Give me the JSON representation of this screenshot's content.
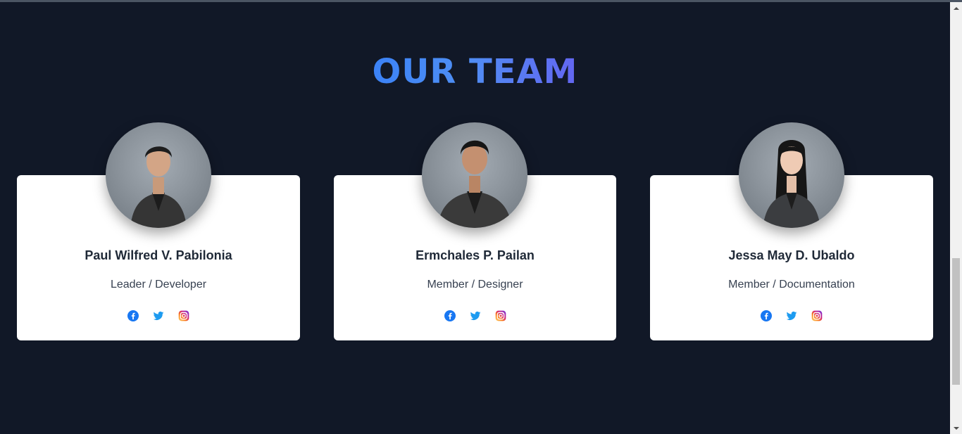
{
  "section": {
    "title": "OUR TEAM"
  },
  "members": [
    {
      "name": "Paul Wilfred V. Pabilonia",
      "role": "Leader / Developer"
    },
    {
      "name": "Ermchales P. Pailan",
      "role": "Member / Designer"
    },
    {
      "name": "Jessa May D. Ubaldo",
      "role": "Member / Documentation"
    }
  ],
  "socials": [
    "facebook-icon",
    "twitter-icon",
    "instagram-icon"
  ],
  "colors": {
    "background": "#111827",
    "title_gradient_start": "#3b82f6",
    "title_gradient_end": "#6366f1",
    "facebook": "#1877f2",
    "twitter": "#1d9bf0"
  }
}
